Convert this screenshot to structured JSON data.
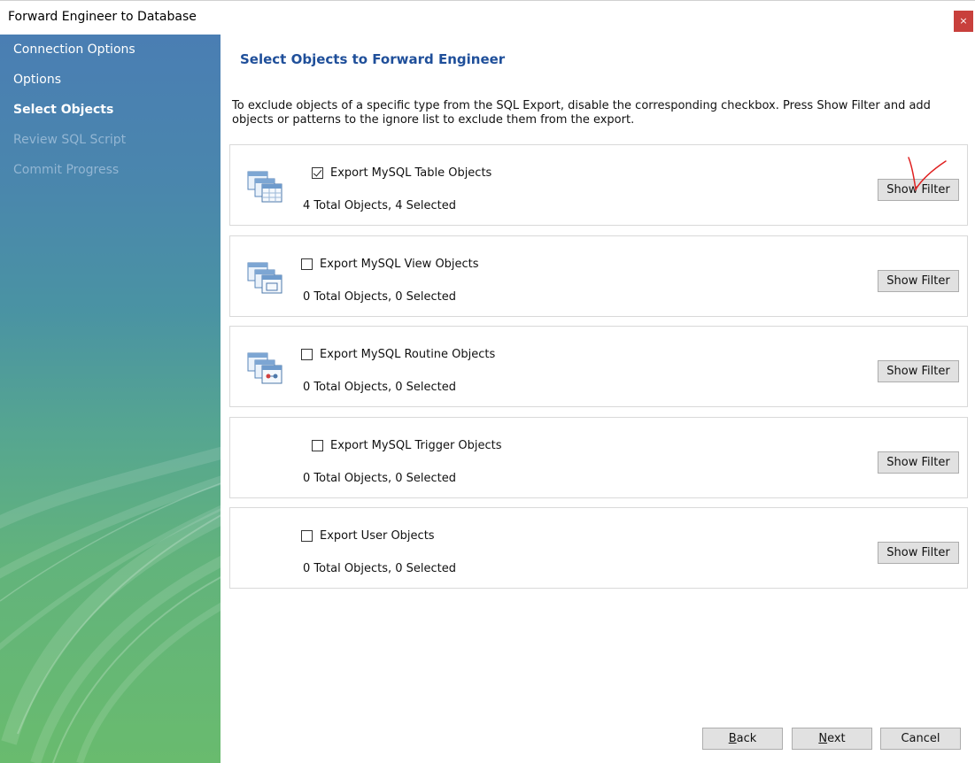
{
  "window": {
    "title": "Forward Engineer to Database",
    "close_glyph": "×"
  },
  "sidebar": {
    "steps": [
      {
        "label": "Connection Options",
        "state": "done"
      },
      {
        "label": "Options",
        "state": "done"
      },
      {
        "label": "Select Objects",
        "state": "current"
      },
      {
        "label": "Review SQL Script",
        "state": "disabled"
      },
      {
        "label": "Commit Progress",
        "state": "disabled"
      }
    ]
  },
  "page": {
    "title": "Select Objects to Forward Engineer",
    "description": "To exclude objects of a specific type from the SQL Export, disable the corresponding checkbox. Press Show Filter and add objects or patterns to the ignore list to exclude them from the export."
  },
  "objects": [
    {
      "label": "Export MySQL Table Objects",
      "checked": true,
      "count": "4 Total Objects, 4 Selected",
      "button": "Show Filter",
      "icon": "table-objects-icon"
    },
    {
      "label": "Export MySQL View Objects",
      "checked": false,
      "count": "0 Total Objects, 0 Selected",
      "button": "Show Filter",
      "icon": "view-objects-icon"
    },
    {
      "label": "Export MySQL Routine Objects",
      "checked": false,
      "count": "0 Total Objects, 0 Selected",
      "button": "Show Filter",
      "icon": "routine-objects-icon"
    },
    {
      "label": "Export MySQL Trigger Objects",
      "checked": false,
      "count": "0 Total Objects, 0 Selected",
      "button": "Show Filter",
      "icon": "none"
    },
    {
      "label": "Export User Objects",
      "checked": false,
      "count": "0 Total Objects, 0 Selected",
      "button": "Show Filter",
      "icon": "none"
    }
  ],
  "footer": {
    "back": {
      "mnemonic": "B",
      "rest": "ack"
    },
    "next": {
      "mnemonic": "N",
      "rest": "ext"
    },
    "cancel": "Cancel"
  },
  "colors": {
    "title_blue": "#1f4f9a",
    "annotation_red": "#e02020",
    "close_red": "#c8403c"
  }
}
